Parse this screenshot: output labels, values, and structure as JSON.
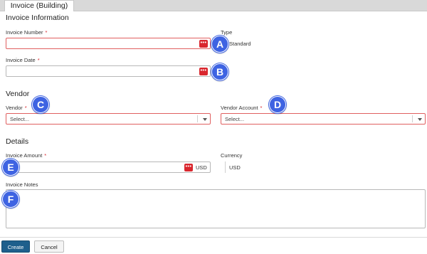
{
  "tab": {
    "label": "Invoice (Building)"
  },
  "sections": {
    "invoice_information": "Invoice Information",
    "vendor": "Vendor",
    "details": "Details"
  },
  "fields": {
    "invoice_number": {
      "label": "Invoice Number",
      "value": ""
    },
    "type": {
      "label": "Type",
      "value": "Standard"
    },
    "invoice_date": {
      "label": "Invoice Date",
      "value": ""
    },
    "vendor": {
      "label": "Vendor",
      "value": "Select..."
    },
    "vendor_account": {
      "label": "Vendor Account",
      "value": "Select..."
    },
    "invoice_amount": {
      "label": "Invoice Amount",
      "value": "",
      "currency_suffix": "USD"
    },
    "currency": {
      "label": "Currency",
      "value": "USD"
    },
    "invoice_notes": {
      "label": "Invoice Notes",
      "value": ""
    }
  },
  "required_marker": "*",
  "lookup_glyph": "•••",
  "callouts": [
    "A",
    "B",
    "C",
    "D",
    "E",
    "F"
  ],
  "buttons": {
    "create": "Create",
    "cancel": "Cancel"
  },
  "colors": {
    "accent_required": "#d9272e",
    "callout": "#3e63e2",
    "primary_button": "#1e5f8c"
  }
}
